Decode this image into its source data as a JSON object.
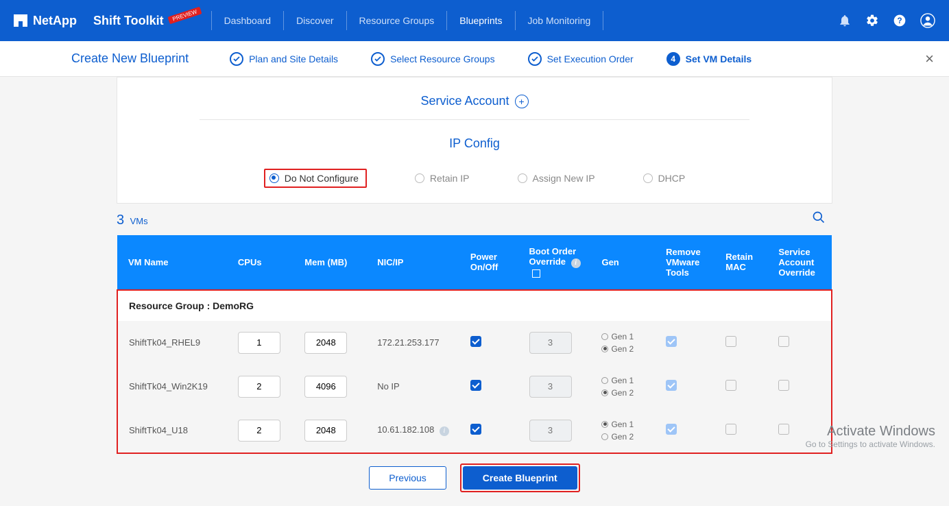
{
  "topnav": {
    "brand": "NetApp",
    "toolkit": "Shift Toolkit",
    "preview_tag": "PREVIEW",
    "links": {
      "dashboard": "Dashboard",
      "discover": "Discover",
      "resource_groups": "Resource Groups",
      "blueprints": "Blueprints",
      "job_monitoring": "Job Monitoring"
    }
  },
  "stepbar": {
    "title": "Create New Blueprint",
    "s1": "Plan and Site Details",
    "s2": "Select Resource Groups",
    "s3": "Set Execution Order",
    "s4": "Set VM Details",
    "s4_num": "4"
  },
  "sections": {
    "service_account": "Service Account",
    "ip_config": "IP Config"
  },
  "ip_options": {
    "do_not": "Do Not Configure",
    "retain": "Retain IP",
    "assign": "Assign New IP",
    "dhcp": "DHCP"
  },
  "vm_header": {
    "count": "3",
    "label": "VMs"
  },
  "table": {
    "headers": {
      "name": "VM Name",
      "cpu": "CPUs",
      "mem": "Mem (MB)",
      "nic": "NIC/IP",
      "power": "Power On/Off",
      "boot": "Boot Order Override",
      "gen": "Gen",
      "remove": "Remove VMware Tools",
      "mac": "Retain MAC",
      "sa": "Service Account Override"
    },
    "rg_label": "Resource Group : DemoRG",
    "rows": [
      {
        "name": "ShiftTk04_RHEL9",
        "cpu": "1",
        "mem": "2048",
        "nic": "172.21.253.177",
        "power": true,
        "boot": "3",
        "gen": "Gen 2",
        "remove": true,
        "mac": false,
        "sa": false
      },
      {
        "name": "ShiftTk04_Win2K19",
        "cpu": "2",
        "mem": "4096",
        "nic": "No IP",
        "power": true,
        "boot": "3",
        "gen": "Gen 2",
        "remove": true,
        "mac": false,
        "sa": false
      },
      {
        "name": "ShiftTk04_U18",
        "cpu": "2",
        "mem": "2048",
        "nic": "10.61.182.108",
        "power": true,
        "boot": "3",
        "gen": "Gen 1",
        "remove": true,
        "mac": false,
        "sa": false
      }
    ],
    "gen_labels": {
      "g1": "Gen 1",
      "g2": "Gen 2"
    }
  },
  "buttons": {
    "previous": "Previous",
    "create": "Create Blueprint"
  },
  "watermark": {
    "title": "Activate Windows",
    "sub": "Go to Settings to activate Windows."
  }
}
